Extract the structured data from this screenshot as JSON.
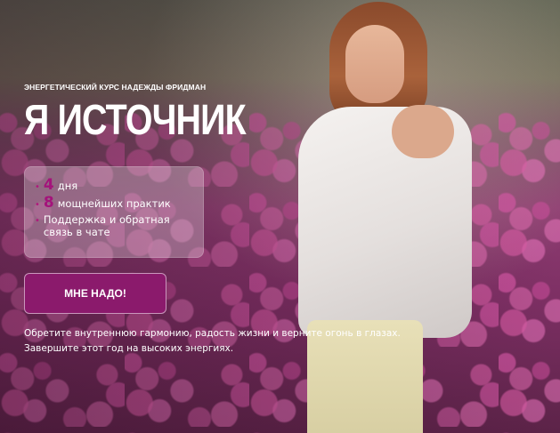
{
  "hero": {
    "eyebrow": "ЭНЕРГЕТИЧЕСКИЙ КУРС НАДЕЖДЫ ФРИДМАН",
    "title": "Я ИСТОЧНИК",
    "features": [
      {
        "bullet": "•",
        "number": "4",
        "text": "дня"
      },
      {
        "bullet": "•",
        "number": "8",
        "text": "мощнейших практик"
      },
      {
        "bullet": "•",
        "number": "",
        "text": "Поддержка и обратная связь в чате"
      }
    ],
    "cta_label": "МНЕ НАДО!",
    "description_line1": "Обретите внутреннюю гармонию, радость жизни и верните огонь в глазах.",
    "description_line2": "Завершите этот год на высоких энергиях."
  },
  "colors": {
    "accent": "#8b1a6c",
    "number_accent": "#a4137b",
    "text": "#ffffff"
  }
}
